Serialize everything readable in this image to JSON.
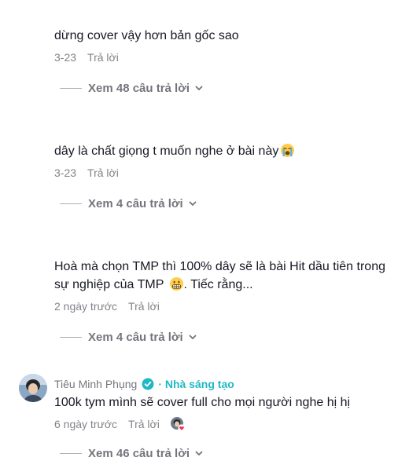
{
  "comments": [
    {
      "text": "dừng cover vậy hơn bản gốc sao",
      "date": "3-23",
      "reply_label": "Trả lời",
      "view_replies": "Xem 48 câu trả lời"
    },
    {
      "text": "dây là chất giọng t muốn nghe ở bài này",
      "date": "3-23",
      "reply_label": "Trả lời",
      "view_replies": "Xem 4 câu trả lời",
      "emoji": "loudly-crying-emoji"
    },
    {
      "text_line1": "Hoà mà chọn TMP thì 100% dây sẽ là bài Hit dầu tiên trong",
      "text_line2": "sự nghiệp của TMP",
      "text_tail": ". Tiếc rằng...",
      "date": "2 ngày trước",
      "reply_label": "Trả lời",
      "view_replies": "Xem 4 câu trả lời",
      "emoji": "grimacing-emoji"
    },
    {
      "author": "Tiêu Minh Phụng",
      "badge": "Nhà sáng tạo",
      "text": "100k tym mình sẽ cover full cho mọi người nghe hị hị",
      "date": "6 ngày trước",
      "reply_label": "Trả lời",
      "view_replies": "Xem 46 câu trả lời",
      "verified_icon": "verified-check-icon"
    }
  ],
  "colors": {
    "creator_accent": "#20b8c4",
    "liked_heart": "#fe2c55"
  }
}
